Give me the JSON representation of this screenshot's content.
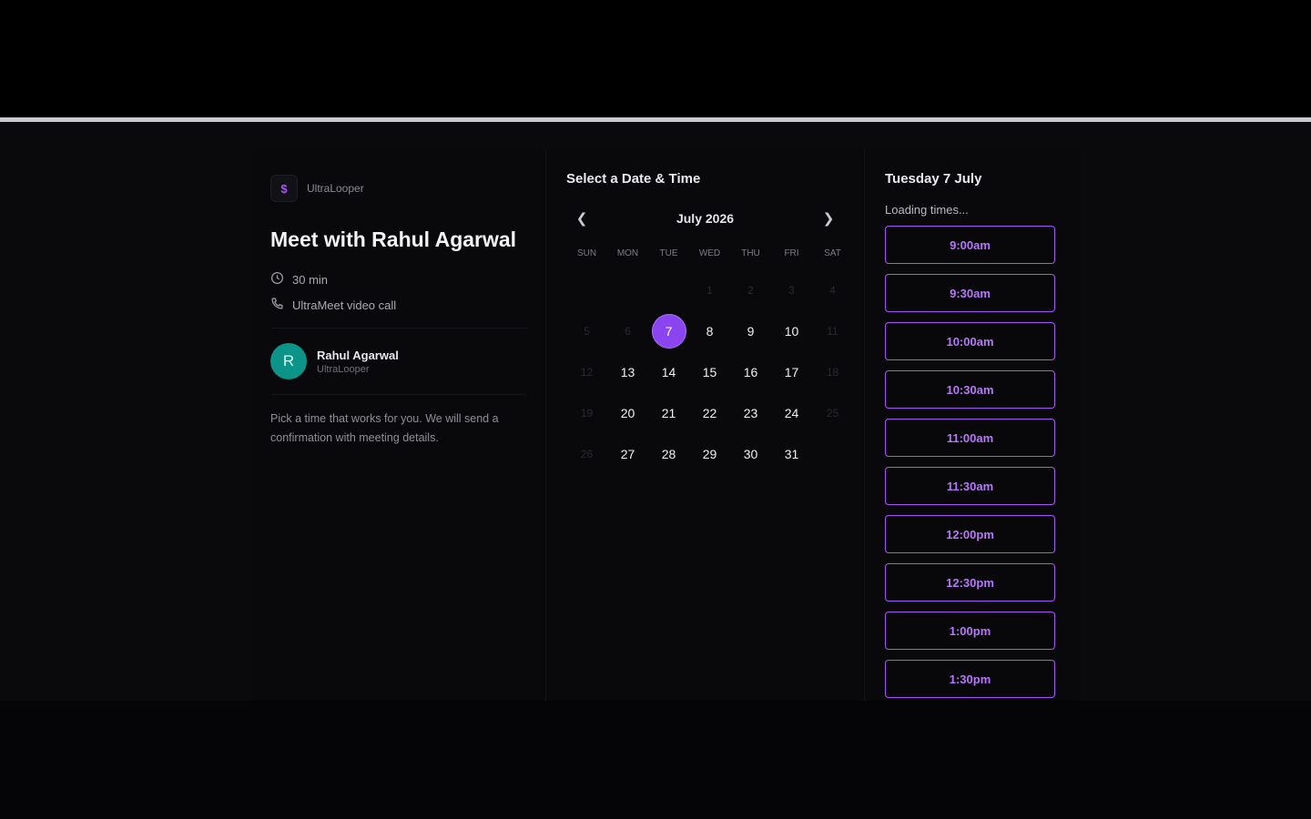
{
  "brand": {
    "name": "UltraLooper",
    "logo_letter": "$"
  },
  "event": {
    "title": "Meet with Rahul Agarwal",
    "duration": "30 min",
    "location": "UltraMeet video call",
    "description": "Pick a time that works for you. We will send a confirmation with meeting details."
  },
  "host": {
    "initial": "R",
    "name": "Rahul Agarwal",
    "org": "UltraLooper"
  },
  "calendar": {
    "heading": "Select a Date & Time",
    "month": "July 2026",
    "prev_icon": "chevron-left-icon",
    "next_icon": "chevron-right-icon",
    "weekdays": [
      "SUN",
      "MON",
      "TUE",
      "WED",
      "THU",
      "FRI",
      "SAT"
    ],
    "leading_blanks": 3,
    "days": [
      {
        "n": "1",
        "state": "dim"
      },
      {
        "n": "2",
        "state": "dim"
      },
      {
        "n": "3",
        "state": "dim"
      },
      {
        "n": "4",
        "state": "dim"
      },
      {
        "n": "5",
        "state": "dim"
      },
      {
        "n": "6",
        "state": "dim"
      },
      {
        "n": "7",
        "state": "selected"
      },
      {
        "n": "8",
        "state": "avail"
      },
      {
        "n": "9",
        "state": "avail"
      },
      {
        "n": "10",
        "state": "avail"
      },
      {
        "n": "11",
        "state": "dim"
      },
      {
        "n": "12",
        "state": "dim"
      },
      {
        "n": "13",
        "state": "avail"
      },
      {
        "n": "14",
        "state": "avail"
      },
      {
        "n": "15",
        "state": "avail"
      },
      {
        "n": "16",
        "state": "avail"
      },
      {
        "n": "17",
        "state": "avail"
      },
      {
        "n": "18",
        "state": "dim"
      },
      {
        "n": "19",
        "state": "dim"
      },
      {
        "n": "20",
        "state": "avail"
      },
      {
        "n": "21",
        "state": "avail"
      },
      {
        "n": "22",
        "state": "avail"
      },
      {
        "n": "23",
        "state": "avail"
      },
      {
        "n": "24",
        "state": "avail"
      },
      {
        "n": "25",
        "state": "dim"
      },
      {
        "n": "26",
        "state": "dim"
      },
      {
        "n": "27",
        "state": "avail"
      },
      {
        "n": "28",
        "state": "avail"
      },
      {
        "n": "29",
        "state": "avail"
      },
      {
        "n": "30",
        "state": "avail"
      },
      {
        "n": "31",
        "state": "avail"
      }
    ]
  },
  "times": {
    "date_heading": "Tuesday 7 July",
    "status": "Loading times...",
    "slots": [
      "9:00am",
      "9:30am",
      "10:00am",
      "10:30am",
      "11:00am",
      "11:30am",
      "12:00pm",
      "12:30pm",
      "1:00pm",
      "1:30pm"
    ]
  },
  "colors": {
    "accent": "#a855f7",
    "selected_day": "#8b45f0",
    "avatar": "#0d9488",
    "background": "#09090c"
  }
}
